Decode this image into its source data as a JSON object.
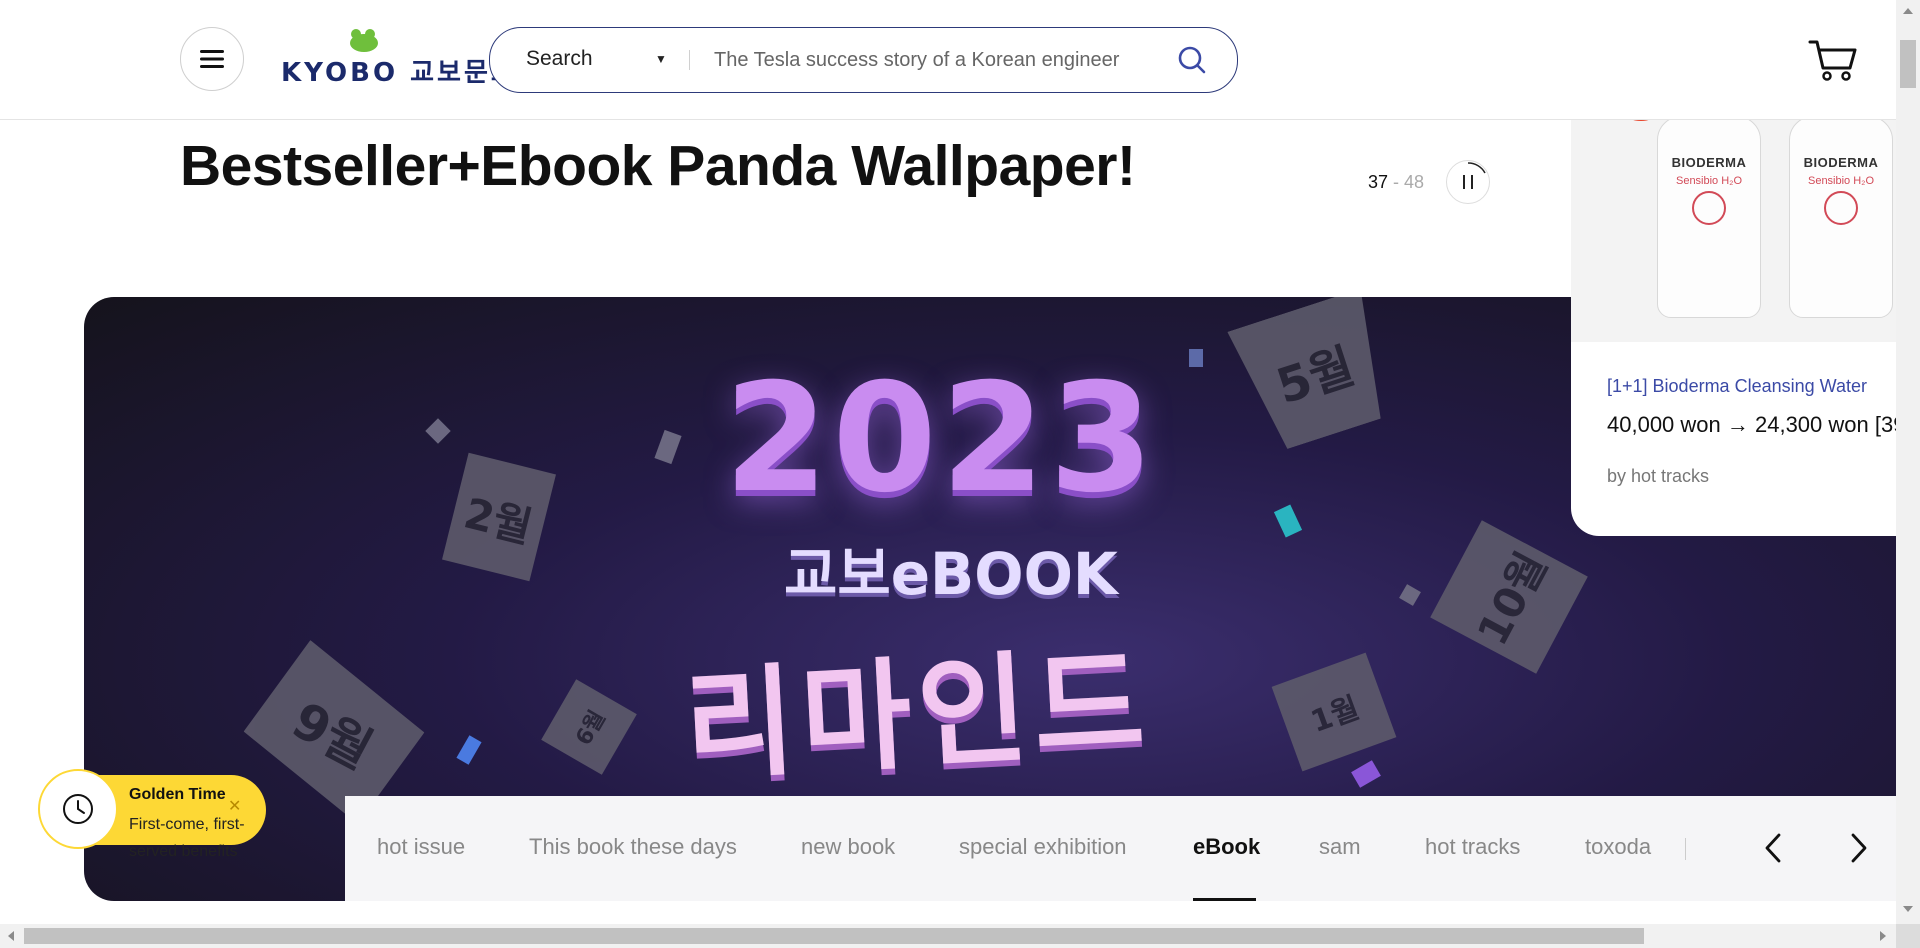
{
  "header": {
    "logo_text": "KYOBO 교보문고",
    "search": {
      "category": "Search",
      "placeholder": "The Tesla success story of a Korean engineer"
    }
  },
  "section": {
    "title": "Bestseller+Ebook Panda Wallpaper!",
    "pager_current": "37",
    "pager_separator": " - ",
    "pager_total": "48"
  },
  "banner": {
    "year": "2023",
    "brand": "교보eBOOK",
    "headline": "리마인드",
    "months": [
      "2월",
      "5월",
      "10월",
      "9월",
      "1월",
      "6월"
    ]
  },
  "product_card": {
    "title": "[1+1] Bioderma Cleansing Water",
    "price": "40,000 won → 24,300 won [39",
    "by": "by hot tracks",
    "bottle_brand": "BIODERMA",
    "bottle_product": "Sensibio H₂O"
  },
  "tabs": {
    "items": [
      "hot issue",
      "This book these days",
      "new book",
      "special exhibition",
      "eBook",
      "sam",
      "hot tracks",
      "toxoda"
    ],
    "active_index": 4
  },
  "golden_time": {
    "title": "Golden Time",
    "subtitle": "First-come, first-served benefits"
  },
  "colors": {
    "brand_navy": "#2d3a7a",
    "golden_yellow": "#fdd835",
    "card_link": "#3b4aa6"
  }
}
